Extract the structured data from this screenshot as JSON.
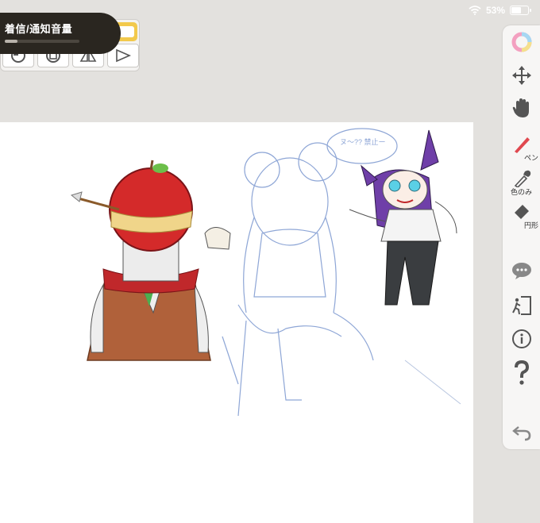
{
  "status_bar": {
    "battery": "53%",
    "battery_level": 0.53
  },
  "volume_hud": {
    "label": "着信/通知音量",
    "level": 0.17
  },
  "shape_tools": [
    "fill-arc-icon",
    "rectangle-icon",
    "symmetry-icon",
    "triangle-icon"
  ],
  "right_toolbar": {
    "pen_label": "ペン",
    "eyedropper_label": "色のみ",
    "shape_label": "円形"
  },
  "sketch": {
    "speech_bubble_text": "ヌ〜?? 禁止ー"
  },
  "colors": {
    "hud_bg": "#2a2620",
    "accent_yellow": "#f2c94c",
    "pen_red": "#e0484f",
    "apple_red": "#d42a2a"
  }
}
